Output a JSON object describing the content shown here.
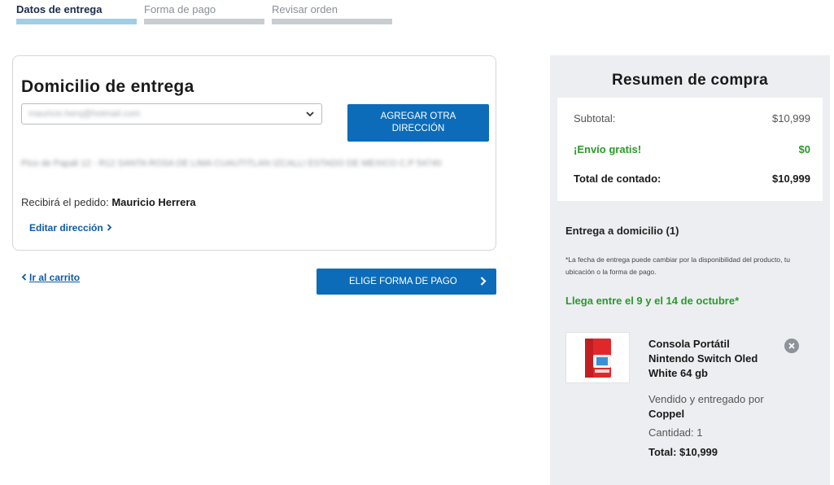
{
  "steps": [
    {
      "label": "Datos de entrega",
      "active": true
    },
    {
      "label": "Forma de pago",
      "active": false
    },
    {
      "label": "Revisar orden",
      "active": false
    }
  ],
  "address": {
    "title": "Domicilio de entrega",
    "selected_email_blurred": "mauricio.herq@hotmail.com",
    "add_button": "AGREGAR OTRA DIRECCIÓN",
    "address_blurred": "Pico de Papali 12 - R12 SANTA ROSA DE LIMA CUAUTITLAN IZCALLI ESTADO DE MEXICO C.P 54740",
    "receiver_prefix": "Recibirá el pedido:",
    "receiver_name": "Mauricio Herrera",
    "edit_link": "Editar dirección"
  },
  "nav": {
    "back_link": "Ir al carrito",
    "pay_button": "ELIGE FORMA DE PAGO"
  },
  "summary": {
    "title": "Resumen de compra",
    "subtotal_label": "Subtotal:",
    "subtotal_value": "$10,999",
    "shipping_label": "¡Envío gratis!",
    "shipping_value": "$0",
    "total_label": "Total de contado:",
    "total_value": "$10,999",
    "delivery_title": "Entrega a domicilio (1)",
    "delivery_note": "*La fecha de entrega puede cambiar por la disponibilidad del producto, tu ubicación o la forma de pago.",
    "arrival": "Llega entre el 9 y el 14 de octubre*",
    "product": {
      "name": "Consola Portátil Nintendo Switch Oled White 64 gb",
      "sold_prefix": "Vendido y entregado por",
      "seller": "Coppel",
      "quantity": "Cantidad: 1",
      "total": "Total: $10,999"
    }
  },
  "colors": {
    "primary_button": "#0c6cb9",
    "link": "#0c5aa6",
    "success": "#2a9a2a",
    "step_active": "#9fcfe6"
  }
}
